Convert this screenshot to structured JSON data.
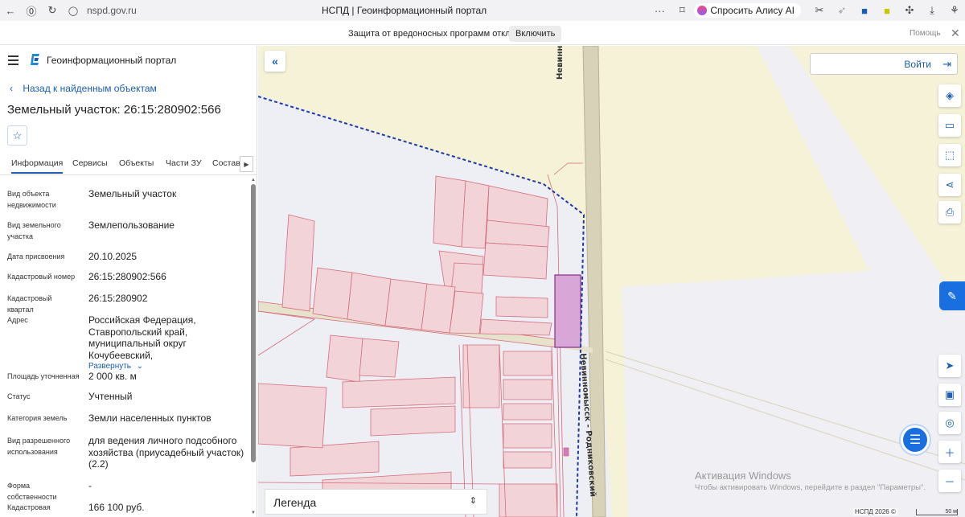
{
  "browser": {
    "url": "nspd.gov.ru",
    "tab_title": "НСПД | Геоинформационный портал",
    "alisa_label": "Спросить Алису AI"
  },
  "protection_bar": {
    "text": "Защита от вредоносных программ отключена",
    "enable_label": "Включить",
    "help_label": "Помощь"
  },
  "header": {
    "portal_title": "Геоинформационный портал"
  },
  "panel": {
    "back_label": "Назад к найденным объектам",
    "object_title": "Земельный участок: 26:15:280902:566",
    "tabs": [
      {
        "label": "Информация"
      },
      {
        "label": "Сервисы"
      },
      {
        "label": "Объекты"
      },
      {
        "label": "Части ЗУ"
      },
      {
        "label": "Состав"
      }
    ],
    "properties": [
      {
        "label": "Вид объекта недвижимости",
        "value": "Земельный участок"
      },
      {
        "label": "Вид земельного участка",
        "value": "Землепользование"
      },
      {
        "label": "Дата присвоения",
        "value": "20.10.2025"
      },
      {
        "label": "Кадастровый номер",
        "value": "26:15:280902:566"
      },
      {
        "label": "Кадастровый квартал",
        "value": "26:15:280902"
      },
      {
        "label": "Адрес",
        "value": "Российская Федерация, Ставропольский край, муниципальный округ Кочубеевский,",
        "expand_label": "Развернуть"
      },
      {
        "label": "Площадь уточненная",
        "value": "2 000 кв. м"
      },
      {
        "label": "Статус",
        "value": "Учтенный"
      },
      {
        "label": "Категория земель",
        "value": "Земли населенных пунктов"
      },
      {
        "label": "Вид разрешенного использования",
        "value": "для ведения личного подсобного хозяйства (приусадебный участок) (2.2)"
      },
      {
        "label": "Форма собственности",
        "value": "-"
      },
      {
        "label": "Кадастровая",
        "value": "166 100 руб."
      }
    ]
  },
  "map": {
    "login_label": "Войти",
    "legend_label": "Легенда",
    "road_labels": [
      "Невинномысск",
      "Невинномысск - Родниковский"
    ],
    "windows_watermark": {
      "title": "Активация Windows",
      "subtitle": "Чтобы активировать Windows, перейдите в раздел \"Параметры\"."
    },
    "copyright": "НСПД 2026 ©",
    "scale_label": "50 м",
    "colors": {
      "parcel_fill": "#f2d4d8",
      "parcel_stroke": "#d56b7a",
      "selected_fill": "#d9a6d8",
      "selected_stroke": "#8a2b8f",
      "boundary": "#1f3a9e",
      "road": "#cfc9a8"
    }
  }
}
